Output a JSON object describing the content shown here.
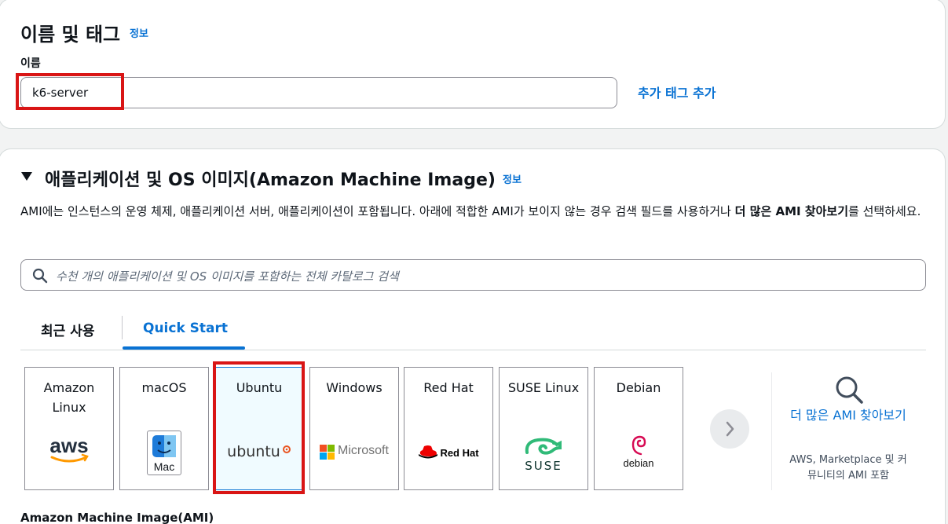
{
  "name_section": {
    "title": "이름 및 태그",
    "info": "정보",
    "name_label": "이름",
    "name_value": "k6-server",
    "add_tag_link": "추가 태그 추가"
  },
  "ami_section": {
    "title": "애플리케이션 및 OS 이미지(Amazon Machine Image)",
    "info": "정보",
    "description_part1": "AMI에는 인스턴스의 운영 체제, 애플리케이션 서버, 애플리케이션이 포함됩니다. 아래에 적합한 AMI가 보이지 않는 경우 검색 필드를 사용하거나 ",
    "description_bold": "더 많은 AMI 찾아보기",
    "description_part2": "를 선택하세요.",
    "search_placeholder": "수천 개의 애플리케이션 및 OS 이미지를 포함하는 전체 카탈로그 검색",
    "tabs": [
      {
        "label": "최근 사용",
        "active": false
      },
      {
        "label": "Quick Start",
        "active": true
      }
    ],
    "cards": [
      {
        "title": "Amazon Linux",
        "logo": "aws-logo",
        "selected": false
      },
      {
        "title": "macOS",
        "logo": "mac-logo",
        "logo_text": "Mac",
        "selected": false
      },
      {
        "title": "Ubuntu",
        "logo": "ubuntu-logo",
        "logo_text": "ubuntu",
        "selected": true
      },
      {
        "title": "Windows",
        "logo": "microsoft-logo",
        "logo_text": "Microsoft",
        "selected": false
      },
      {
        "title": "Red Hat",
        "logo": "redhat-logo",
        "logo_text": "Red Hat",
        "selected": false
      },
      {
        "title": "SUSE Linux",
        "logo": "suse-logo",
        "logo_text": "SUSE",
        "selected": false
      },
      {
        "title": "Debian",
        "logo": "debian-logo",
        "logo_text": "debian",
        "selected": false
      }
    ],
    "more_ami_link": "더 많은 AMI 찾아보기",
    "more_ami_sub": "AWS, Marketplace 및 커뮤니티의 AMI 포함",
    "ami_label": "Amazon Machine Image(AMI)"
  },
  "colors": {
    "link": "#0972d3",
    "highlight": "#d91515",
    "selected_bg": "#f0fbff"
  }
}
